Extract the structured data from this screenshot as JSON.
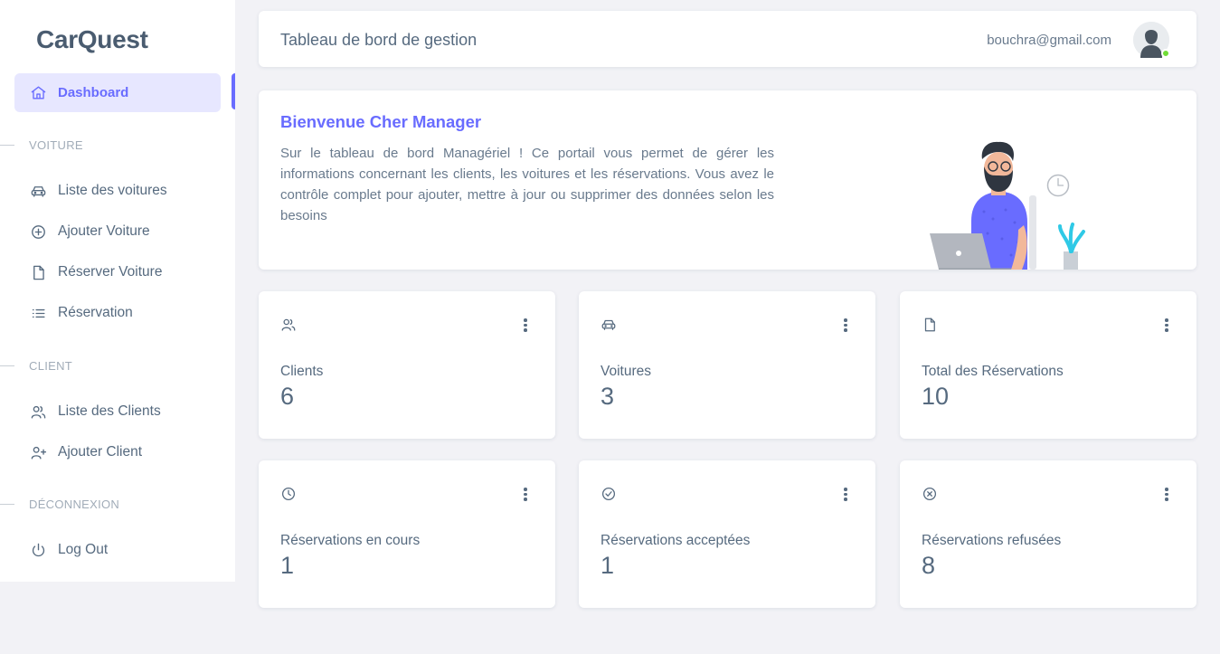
{
  "brand": "CarQuest",
  "sidebar": {
    "active": {
      "label": "Dashboard",
      "icon": "home-icon"
    },
    "sections": [
      {
        "header": "VOITURE",
        "items": [
          {
            "label": "Liste des voitures",
            "icon": "car-icon"
          },
          {
            "label": "Ajouter Voiture",
            "icon": "plus-circle-icon"
          },
          {
            "label": "Réserver Voiture",
            "icon": "file-icon"
          },
          {
            "label": "Réservation",
            "icon": "list-icon"
          }
        ]
      },
      {
        "header": "CLIENT",
        "items": [
          {
            "label": "Liste des Clients",
            "icon": "users-icon"
          },
          {
            "label": "Ajouter Client",
            "icon": "user-plus-icon"
          }
        ]
      },
      {
        "header": "DÉCONNEXION",
        "items": [
          {
            "label": "Log Out",
            "icon": "power-icon"
          }
        ]
      }
    ]
  },
  "topbar": {
    "title": "Tableau de bord de gestion",
    "email": "bouchra@gmail.com"
  },
  "welcome": {
    "title": "Bienvenue Cher Manager",
    "text": "Sur le tableau de bord Managériel ! Ce portail vous permet de gérer les informations concernant les clients, les voitures et les réservations. Vous avez le contrôle complet pour ajouter, mettre à jour ou supprimer des données selon les besoins"
  },
  "stats": [
    {
      "label": "Clients",
      "value": "6",
      "icon": "users-icon"
    },
    {
      "label": "Voitures",
      "value": "3",
      "icon": "car-icon"
    },
    {
      "label": "Total des Réservations",
      "value": "10",
      "icon": "file-icon"
    },
    {
      "label": "Réservations en cours",
      "value": "1",
      "icon": "clock-icon"
    },
    {
      "label": "Réservations acceptées",
      "value": "1",
      "icon": "check-circle-icon"
    },
    {
      "label": "Réservations refusées",
      "value": "8",
      "icon": "x-circle-icon"
    }
  ],
  "colors": {
    "accent": "#696cff",
    "accent_light": "#e7e7ff",
    "text": "#566a7f",
    "muted": "#a1acb8",
    "background": "#f2f2f6",
    "online": "#71dd37"
  }
}
